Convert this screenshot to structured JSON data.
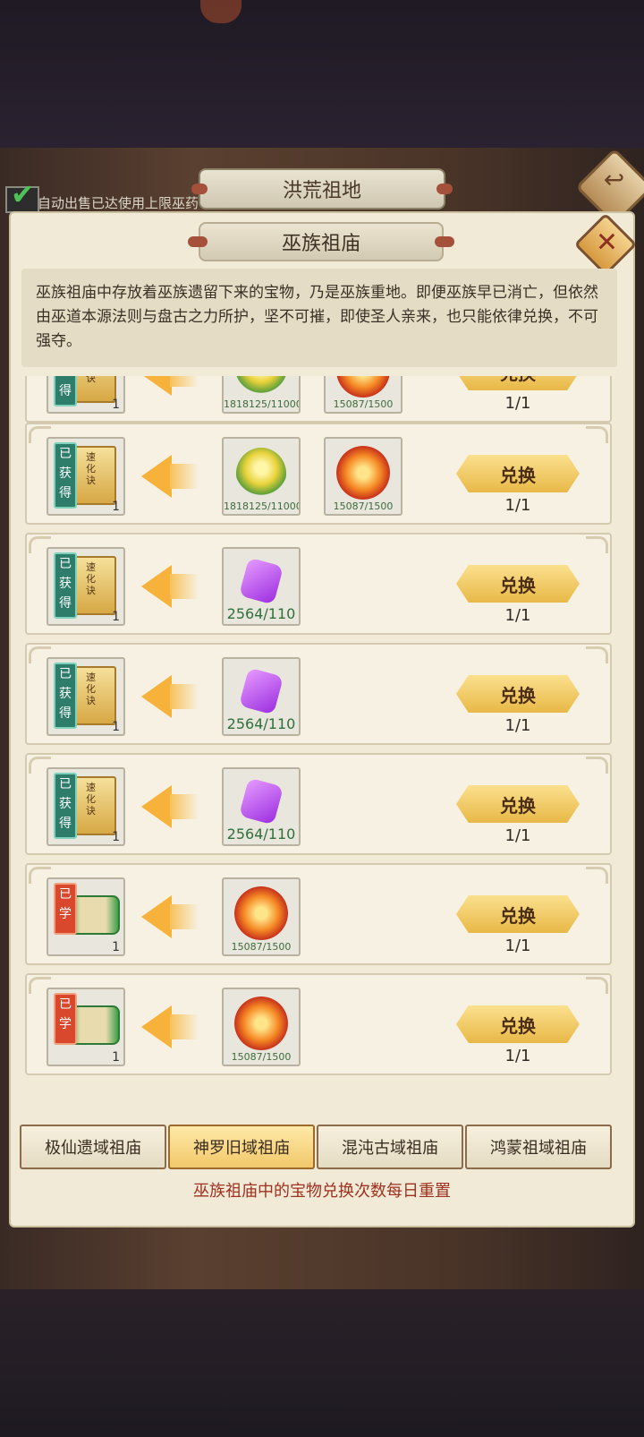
{
  "header": {
    "outer_title": "洪荒祖地",
    "auto_sell_label": "自动出售已达使用上限巫药"
  },
  "panel": {
    "title": "巫族祖庙",
    "description": "巫族祖庙中存放着巫族遗留下来的宝物，乃是巫族重地。即便巫族早已消亡，但依然由巫道本源法则与盘古之力所护，坚不可摧，即使圣人亲来，也只能依律兑换，不可强夺。"
  },
  "rows": [
    {
      "reward_type": "book",
      "reward_tag": "已获得",
      "reward_book_title": "速化诀",
      "reward_qty": "1",
      "cost1_type": "flame-pot",
      "cost1_count": "1818125/11000",
      "cost2_type": "fire",
      "cost2_count": "15087/1500",
      "button": "兑换",
      "limit": "1/1"
    },
    {
      "reward_type": "book",
      "reward_tag": "已获得",
      "reward_book_title": "速化诀",
      "reward_qty": "1",
      "cost1_type": "flame-pot",
      "cost1_count": "1818125/11000",
      "cost2_type": "fire",
      "cost2_count": "15087/1500",
      "button": "兑换",
      "limit": "1/1"
    },
    {
      "reward_type": "book",
      "reward_tag": "已获得",
      "reward_book_title": "速化诀",
      "reward_qty": "1",
      "cost1_type": "gem",
      "cost1_count": "2564/110",
      "button": "兑换",
      "limit": "1/1"
    },
    {
      "reward_type": "book",
      "reward_tag": "已获得",
      "reward_book_title": "速化诀",
      "reward_qty": "1",
      "cost1_type": "gem",
      "cost1_count": "2564/110",
      "button": "兑换",
      "limit": "1/1"
    },
    {
      "reward_type": "book",
      "reward_tag": "已获得",
      "reward_book_title": "速化诀",
      "reward_qty": "1",
      "cost1_type": "gem",
      "cost1_count": "2564/110",
      "button": "兑换",
      "limit": "1/1"
    },
    {
      "reward_type": "scroll",
      "reward_tag": "已学",
      "reward_qty": "1",
      "cost1_type": "fire",
      "cost1_count": "15087/1500",
      "button": "兑换",
      "limit": "1/1"
    },
    {
      "reward_type": "scroll",
      "reward_tag": "已学",
      "reward_qty": "1",
      "cost1_type": "fire",
      "cost1_count": "15087/1500",
      "button": "兑换",
      "limit": "1/1"
    }
  ],
  "tabs": [
    "极仙遗域祖庙",
    "神罗旧域祖庙",
    "混沌古域祖庙",
    "鸿蒙祖域祖庙"
  ],
  "active_tab_index": 1,
  "footer_note": "巫族祖庙中的宝物兑换次数每日重置",
  "colors": {
    "accent": "#f2c86a",
    "note": "#a0301f",
    "button": "#e8b847"
  }
}
